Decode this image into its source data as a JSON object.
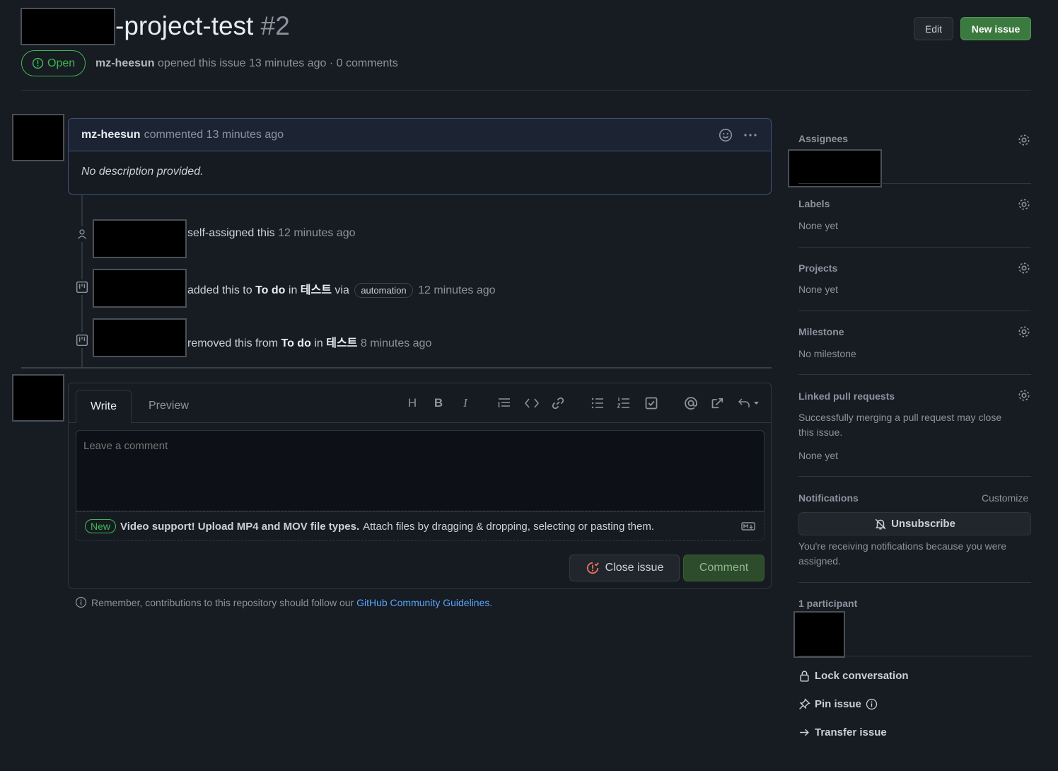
{
  "issue": {
    "title": "-project-test",
    "number": "#2",
    "state": "Open",
    "author": "mz-heesun",
    "opened_text": "opened this issue 13 minutes ago · 0 comments"
  },
  "header_actions": {
    "edit": "Edit",
    "new_issue": "New issue"
  },
  "comment": {
    "author": "mz-heesun",
    "action": "commented 13 minutes ago",
    "body": "No description provided."
  },
  "timeline": [
    {
      "icon": "person-icon",
      "text": "self-assigned this",
      "time": "12 minutes ago"
    },
    {
      "icon": "project-icon",
      "pre": "added this to",
      "column": "To do",
      "in": "in",
      "project": "테스트",
      "via": "via",
      "pill": "automation",
      "time": "12 minutes ago"
    },
    {
      "icon": "project-icon",
      "pre": "removed this from",
      "column": "To do",
      "in": "in",
      "project": "테스트",
      "time": "8 minutes ago"
    }
  ],
  "composer": {
    "tab_write": "Write",
    "tab_preview": "Preview",
    "toolbar": [
      "H",
      "B",
      "I"
    ],
    "placeholder": "Leave a comment",
    "new_badge": "New",
    "upload_bold": "Video support! Upload MP4 and MOV file types.",
    "upload_text": "Attach files by dragging & dropping, selecting or pasting them.",
    "close_issue": "Close issue",
    "comment": "Comment",
    "guidelines_text": "Remember, contributions to this repository should follow our",
    "guidelines_link": "GitHub Community Guidelines",
    "guidelines_end": "."
  },
  "sidebar": {
    "assignees": "Assignees",
    "labels": "Labels",
    "labels_value": "None yet",
    "projects": "Projects",
    "projects_value": "None yet",
    "milestone": "Milestone",
    "milestone_value": "No milestone",
    "linked_prs": "Linked pull requests",
    "linked_prs_desc_1": "Successfully merging a pull request may close",
    "linked_prs_desc_2": "this issue.",
    "linked_prs_value": "None yet",
    "notifications": "Notifications",
    "customize": "Customize",
    "unsubscribe": "Unsubscribe",
    "notif_reason_1": "You're receiving notifications because you were",
    "notif_reason_2": "assigned.",
    "participants": "1 participant",
    "lock": "Lock conversation",
    "pin": "Pin issue",
    "transfer": "Transfer issue"
  },
  "colors": {
    "background": "#171b22",
    "accent_green": "#3fb950",
    "link_blue": "#58a6ff",
    "close_icon": "#f0735b"
  }
}
